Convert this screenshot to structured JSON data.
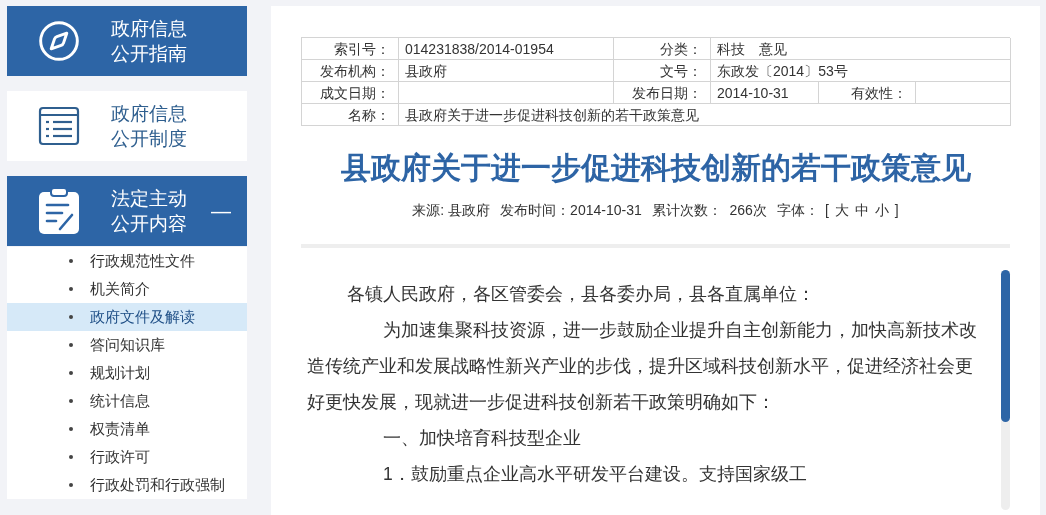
{
  "sidebar": {
    "sections": [
      {
        "title": [
          "政府信息",
          "公开指南"
        ],
        "highlighted": true
      },
      {
        "title": [
          "政府信息",
          "公开制度"
        ],
        "highlighted": false
      },
      {
        "title": [
          "法定主动",
          "公开内容"
        ],
        "highlighted": true,
        "expanded": true,
        "toggle": "—",
        "children": [
          {
            "label": "行政规范性文件",
            "selected": false
          },
          {
            "label": "机关简介",
            "selected": false
          },
          {
            "label": "政府文件及解读",
            "selected": true
          },
          {
            "label": "答问知识库",
            "selected": false
          },
          {
            "label": "规划计划",
            "selected": false
          },
          {
            "label": "统计信息",
            "selected": false
          },
          {
            "label": "权责清单",
            "selected": false
          },
          {
            "label": "行政许可",
            "selected": false
          },
          {
            "label": "行政处罚和行政强制",
            "selected": false
          }
        ]
      }
    ]
  },
  "meta_table": {
    "rows": [
      [
        {
          "label": "索引号：",
          "value": "014231838/2014-01954"
        },
        {
          "label": "分类：",
          "value": "科技　意见"
        }
      ],
      [
        {
          "label": "发布机构：",
          "value": "县政府"
        },
        {
          "label": "文号：",
          "value": "东政发〔2014〕53号"
        }
      ],
      [
        {
          "label": "成文日期："
        },
        {
          "label": "发布日期：",
          "value": "2014-10-31"
        },
        {
          "label": "有效性："
        }
      ],
      [
        {
          "label": "名称：",
          "value": "县政府关于进一步促进科技创新的若干政策意见"
        }
      ]
    ]
  },
  "article": {
    "title": "县政府关于进一步促进科技创新的若干政策意见",
    "info": [
      "来源: 县政府",
      "发布时间：2014-10-31",
      "累计次数：  266次"
    ],
    "font_size": {
      "label": "字体：",
      "open": "[",
      "options": [
        "大",
        "中",
        "小"
      ],
      "close": "]"
    },
    "paragraphs": [
      {
        "kind": "salutation",
        "text": "各镇人民政府，各区管委会，县各委办局，县各直属单位："
      },
      {
        "kind": "body",
        "text": "为加速集聚科技资源，进一步鼓励企业提升自主创新能力，加快高新技术改造传统产业和发展战略性新兴产业的步伐，提升区域科技创新水平，促进经济社会更好更快发展，现就进一步促进科技创新若干政策明确如下："
      },
      {
        "kind": "body",
        "text": "一、加快培育科技型企业"
      },
      {
        "kind": "body",
        "text": "1．鼓励重点企业高水平研发平台建设。支持国家级工"
      }
    ]
  }
}
